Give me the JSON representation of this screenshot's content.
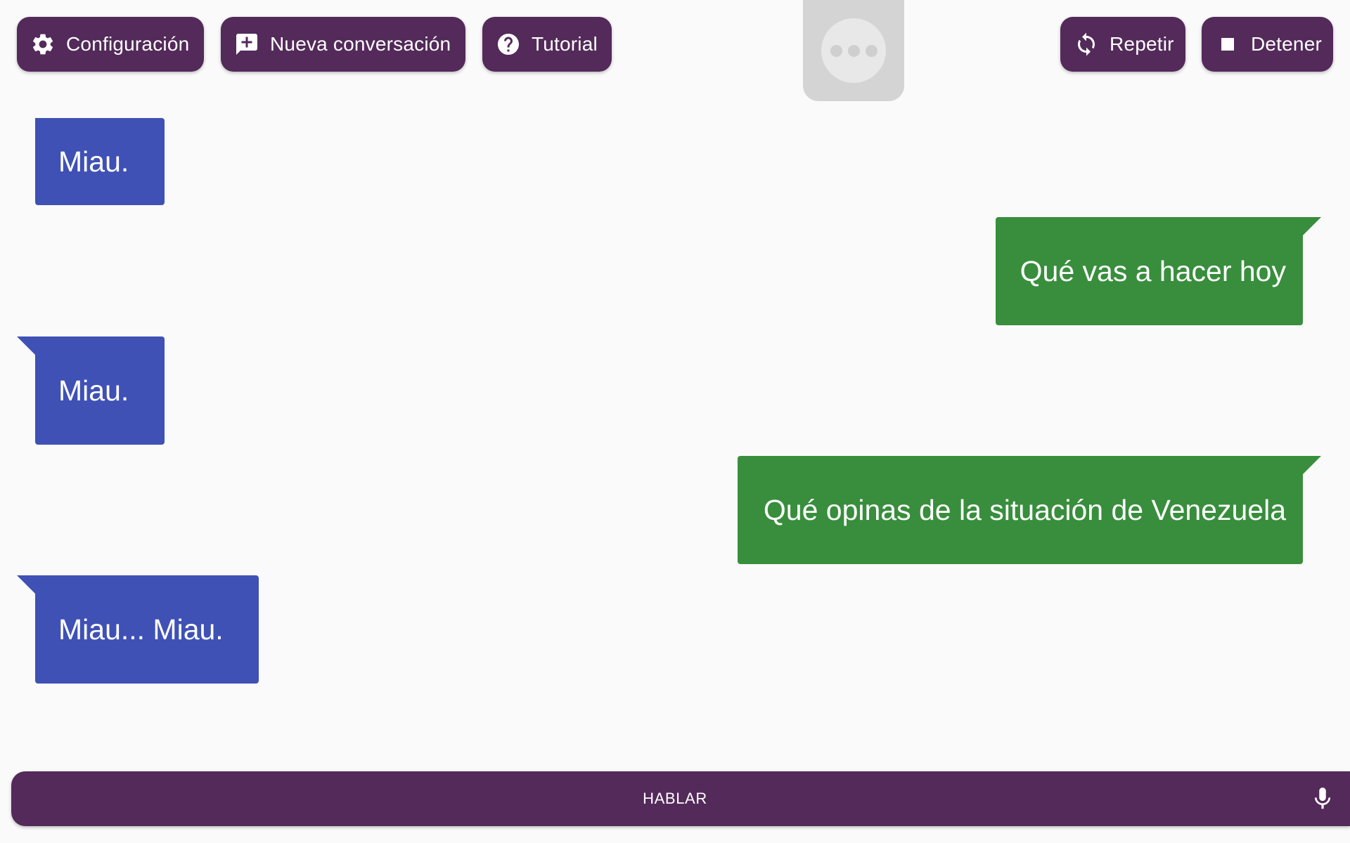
{
  "toolbar": {
    "settings": {
      "label": "Configuración",
      "icon": "gear-icon"
    },
    "new_conversation": {
      "label": "Nueva conversación",
      "icon": "add-comment-icon"
    },
    "tutorial": {
      "label": "Tutorial",
      "icon": "help-icon"
    },
    "repeat": {
      "label": "Repetir",
      "icon": "sync-icon"
    },
    "stop": {
      "label": "Detener",
      "icon": "stop-icon"
    }
  },
  "typing_indicator": {
    "icon": "ellipsis-icon"
  },
  "conversation": {
    "messages": [
      {
        "sender": "assistant",
        "text": "Miau."
      },
      {
        "sender": "user",
        "text": "Qué vas a hacer hoy"
      },
      {
        "sender": "assistant",
        "text": "Miau."
      },
      {
        "sender": "user",
        "text": "Qué opinas de la situación de Venezuela"
      },
      {
        "sender": "assistant",
        "text": "Miau... Miau."
      }
    ]
  },
  "talk_bar": {
    "label": "HABLAR",
    "icon": "microphone-icon"
  },
  "colors": {
    "primary": "#532a5a",
    "assistant_bubble": "#3f51b5",
    "user_bubble": "#388e3c",
    "background": "#fafafa"
  }
}
